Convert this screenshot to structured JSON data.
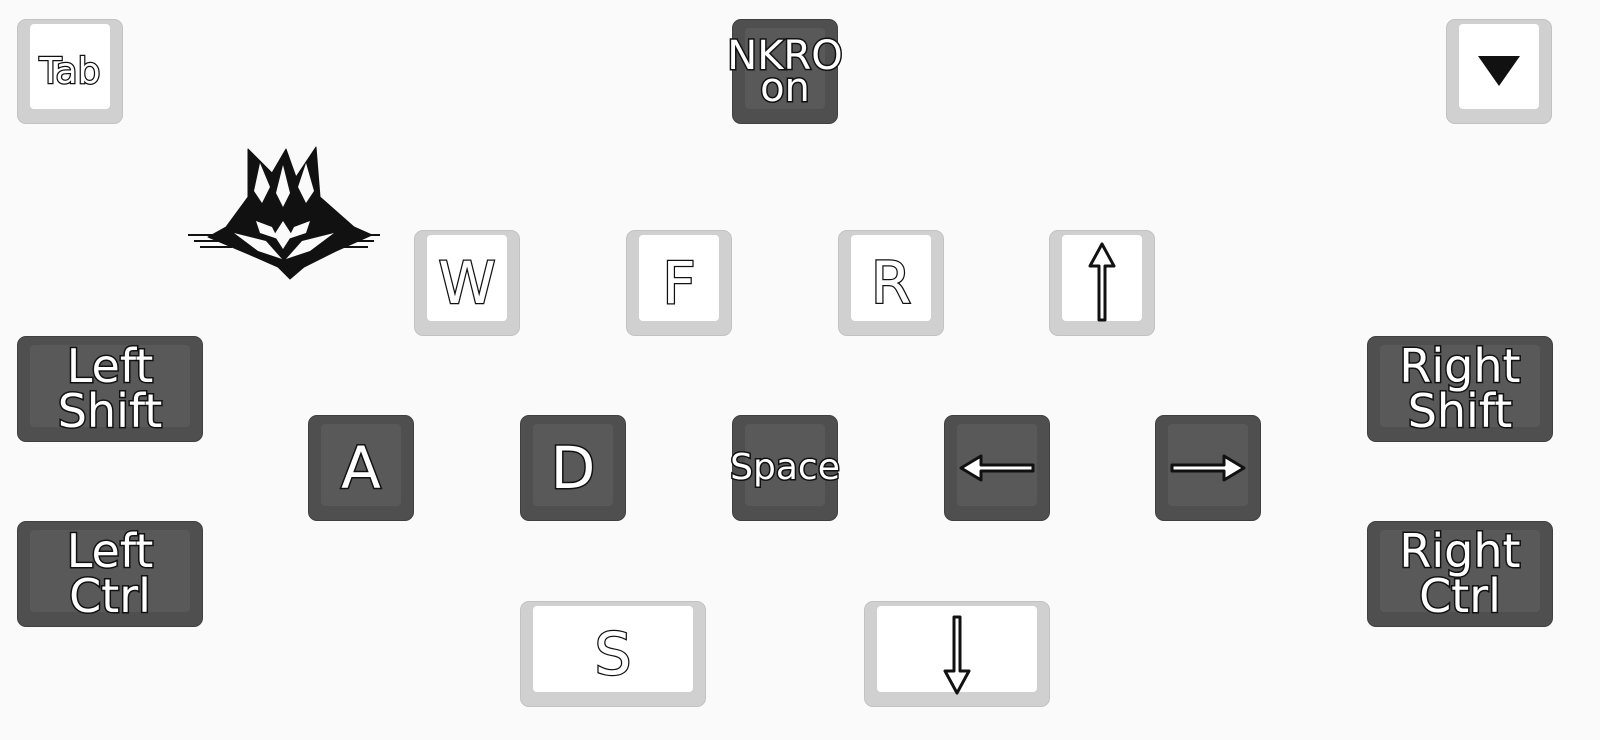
{
  "keys": {
    "tab": "Tab",
    "nkro_line1": "NKRO",
    "nkro_line2": "on",
    "w": "W",
    "f": "F",
    "r": "R",
    "a": "A",
    "d": "D",
    "space": "Space",
    "s": "S",
    "left_shift_line1": "Left",
    "left_shift_line2": "Shift",
    "left_ctrl_line1": "Left",
    "left_ctrl_line2": "Ctrl",
    "right_shift_line1": "Right",
    "right_shift_line2": "Shift",
    "right_ctrl_line1": "Right",
    "right_ctrl_line2": "Ctrl"
  },
  "icons": {
    "menu": "triangle-down-icon",
    "logo": "horned-mask-logo",
    "up": "arrow-up-icon",
    "down": "arrow-down-icon",
    "left": "arrow-left-icon",
    "right": "arrow-right-icon"
  },
  "colors": {
    "background": "#fafafa",
    "light_key": "#d0d0d0",
    "light_key_face": "#ffffff",
    "dark_key": "#4f4f4f",
    "dark_key_face": "#595959",
    "outline": "#111111"
  }
}
